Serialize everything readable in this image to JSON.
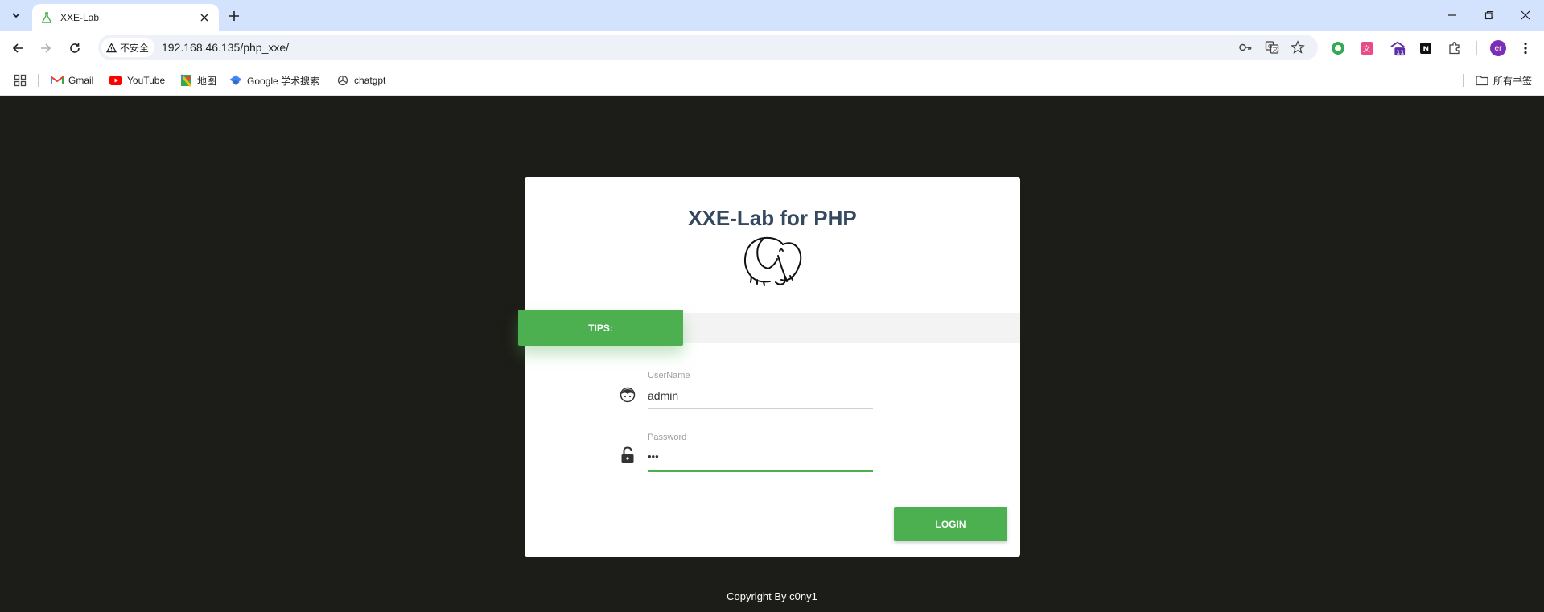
{
  "browser": {
    "tab": {
      "title": "XXE-Lab"
    },
    "address": {
      "security_label": "不安全",
      "url": "192.168.46.135/php_xxe/"
    },
    "bookmarks": [
      {
        "label": "Gmail",
        "icon": "gmail-icon"
      },
      {
        "label": "YouTube",
        "icon": "youtube-icon"
      },
      {
        "label": "地图",
        "icon": "maps-icon"
      },
      {
        "label": "Google 学术搜索",
        "icon": "scholar-icon"
      },
      {
        "label": "chatgpt",
        "icon": "chatgpt-icon"
      }
    ],
    "all_bookmarks_label": "所有书签",
    "profile_initials": "er",
    "extension_badge": "11"
  },
  "page": {
    "title": "XXE-Lab for PHP",
    "tips_label": "TIPS:",
    "username": {
      "label": "UserName",
      "value": "admin"
    },
    "password": {
      "label": "Password",
      "value": "•••"
    },
    "login_label": "LOGIN",
    "copyright": "Copyright By c0ny1"
  },
  "colors": {
    "background": "#1c1c18",
    "accent": "#4caf50",
    "title": "#34495e",
    "chrome_tabstrip": "#d3e3fd"
  }
}
